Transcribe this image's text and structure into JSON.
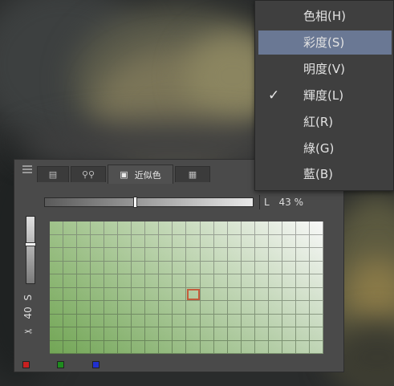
{
  "palette_panel": {
    "tab_label": "近似色",
    "lightness_label": "L",
    "lightness_value": "43 %",
    "lightness_level": 0.43,
    "step_value": "40",
    "step_icon": "scissors-icon",
    "step_suffix": "S",
    "vertical_level": 0.62,
    "grid_rows": 10,
    "grid_cols": 20,
    "selected_cell": {
      "row": 5,
      "col": 10
    },
    "grid_colors": {
      "green": "#7fae63",
      "white": "#f6f6f6"
    },
    "swatches": [
      "#c82020",
      "#1e8c1e",
      "#2030d0"
    ]
  },
  "menu": {
    "items": [
      {
        "label": "色相(H)",
        "checked": false,
        "highlighted": false
      },
      {
        "label": "彩度(S)",
        "checked": false,
        "highlighted": true
      },
      {
        "label": "明度(V)",
        "checked": false,
        "highlighted": false
      },
      {
        "label": "輝度(L)",
        "checked": true,
        "highlighted": false
      },
      {
        "label": "紅(R)",
        "checked": false,
        "highlighted": false
      },
      {
        "label": "綠(G)",
        "checked": false,
        "highlighted": false
      },
      {
        "label": "藍(B)",
        "checked": false,
        "highlighted": false
      }
    ],
    "check_glyph": "✓",
    "highlight_color": "#6a7894"
  }
}
